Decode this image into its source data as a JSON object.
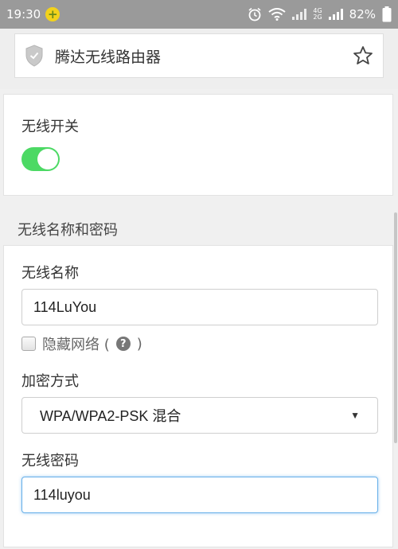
{
  "status_bar": {
    "time": "19:30",
    "network_type_top": "4G",
    "network_type_bottom": "2G",
    "battery": "82%"
  },
  "header": {
    "title": "腾达无线路由器"
  },
  "wireless_switch": {
    "label": "无线开关",
    "enabled": true
  },
  "section": {
    "title": "无线名称和密码"
  },
  "ssid": {
    "label": "无线名称",
    "value": "114LuYou"
  },
  "hide_network": {
    "label": "隐藏网络 (",
    "help": "?",
    "suffix": ")",
    "checked": false
  },
  "encryption": {
    "label": "加密方式",
    "selected": "WPA/WPA2-PSK 混合"
  },
  "password": {
    "label": "无线密码",
    "value": "114luyou"
  },
  "colors": {
    "toggle_on": "#4cd964",
    "status_bar": "#9a9a9a",
    "focus_border": "#66afe9"
  }
}
